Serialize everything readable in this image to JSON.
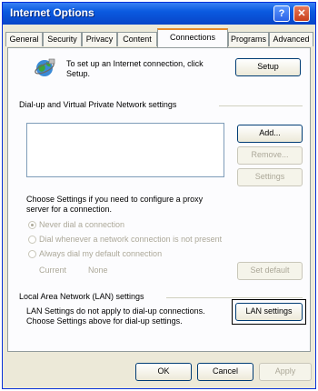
{
  "window": {
    "title": "Internet Options",
    "help_glyph": "?",
    "close_glyph": "✕"
  },
  "tabs": [
    {
      "label": "General"
    },
    {
      "label": "Security"
    },
    {
      "label": "Privacy"
    },
    {
      "label": "Content"
    },
    {
      "label": "Connections"
    },
    {
      "label": "Programs"
    },
    {
      "label": "Advanced"
    }
  ],
  "active_tab": "Connections",
  "setup": {
    "description_line1": "To set up an Internet connection, click",
    "description_line2": "Setup.",
    "button_label": "Setup"
  },
  "dialup": {
    "group_label": "Dial-up and Virtual Private Network settings",
    "add_label": "Add...",
    "remove_label": "Remove...",
    "settings_label": "Settings",
    "proxy_hint_line1": "Choose Settings if you need to configure a proxy",
    "proxy_hint_line2": "server for a connection.",
    "options": [
      {
        "label": "Never dial a connection",
        "selected": true
      },
      {
        "label": "Dial whenever a network connection is not present",
        "selected": false
      },
      {
        "label": "Always dial my default connection",
        "selected": false
      }
    ],
    "current_label": "Current",
    "current_value": "None",
    "set_default_label": "Set default"
  },
  "lan": {
    "group_label": "Local Area Network (LAN) settings",
    "description_line1": "LAN Settings do not apply to dial-up connections.",
    "description_line2": "Choose Settings above for dial-up settings.",
    "button_label": "LAN settings"
  },
  "footer": {
    "ok_label": "OK",
    "cancel_label": "Cancel",
    "apply_label": "Apply"
  },
  "colors": {
    "titlebar": "#0a5ae0",
    "dialog_bg": "#ece9d8",
    "panel_bg": "#fcfcfe",
    "active_tab_accent": "#e68b2c",
    "disabled_text": "#aca899"
  }
}
